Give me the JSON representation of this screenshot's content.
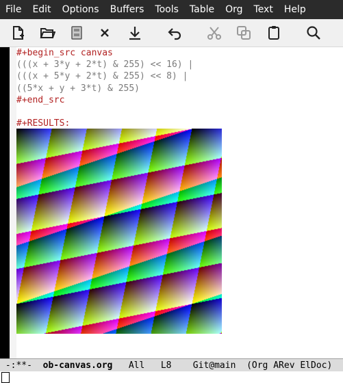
{
  "menubar": {
    "items": [
      "File",
      "Edit",
      "Options",
      "Buffers",
      "Tools",
      "Table",
      "Org",
      "Text",
      "Help"
    ]
  },
  "toolbar": {
    "buttons": [
      {
        "name": "new-file",
        "icon": "new-file-icon"
      },
      {
        "name": "open-folder",
        "icon": "folder-open-icon"
      },
      {
        "name": "save",
        "icon": "save-icon"
      },
      {
        "name": "close",
        "icon": "close-icon"
      },
      {
        "name": "download",
        "icon": "download-icon"
      },
      {
        "name": "undo",
        "icon": "undo-icon"
      },
      {
        "name": "cut",
        "icon": "cut-icon"
      },
      {
        "name": "copy",
        "icon": "copy-icon"
      },
      {
        "name": "paste",
        "icon": "paste-icon"
      },
      {
        "name": "search",
        "icon": "search-icon"
      }
    ]
  },
  "editor": {
    "lines": [
      {
        "text": "#+begin_src canvas",
        "style": "kw"
      },
      {
        "text": "(((x + 3*y + 2*t) & 255) << 16) |",
        "style": "src"
      },
      {
        "text": "(((x + 5*y + 2*t) & 255) << 8) |",
        "style": "src"
      },
      {
        "text": "((5*x + y + 3*t) & 255)",
        "style": "src"
      },
      {
        "text": "#+end_src",
        "style": "kw"
      },
      {
        "text": "",
        "style": "src"
      },
      {
        "text": "#+RESULTS:",
        "style": "kw"
      }
    ]
  },
  "modeline": {
    "status": "-:**-",
    "buffer": "ob-canvas.org",
    "position": "All",
    "line": "L8",
    "vc": "Git@main",
    "modes": "(Org ARev ElDoc)"
  },
  "colors": {
    "menubar_bg": "#2b2b2b",
    "keyword": "#b22222",
    "source": "#7a7a7a",
    "modeline_bg": "#dcdcdc"
  }
}
